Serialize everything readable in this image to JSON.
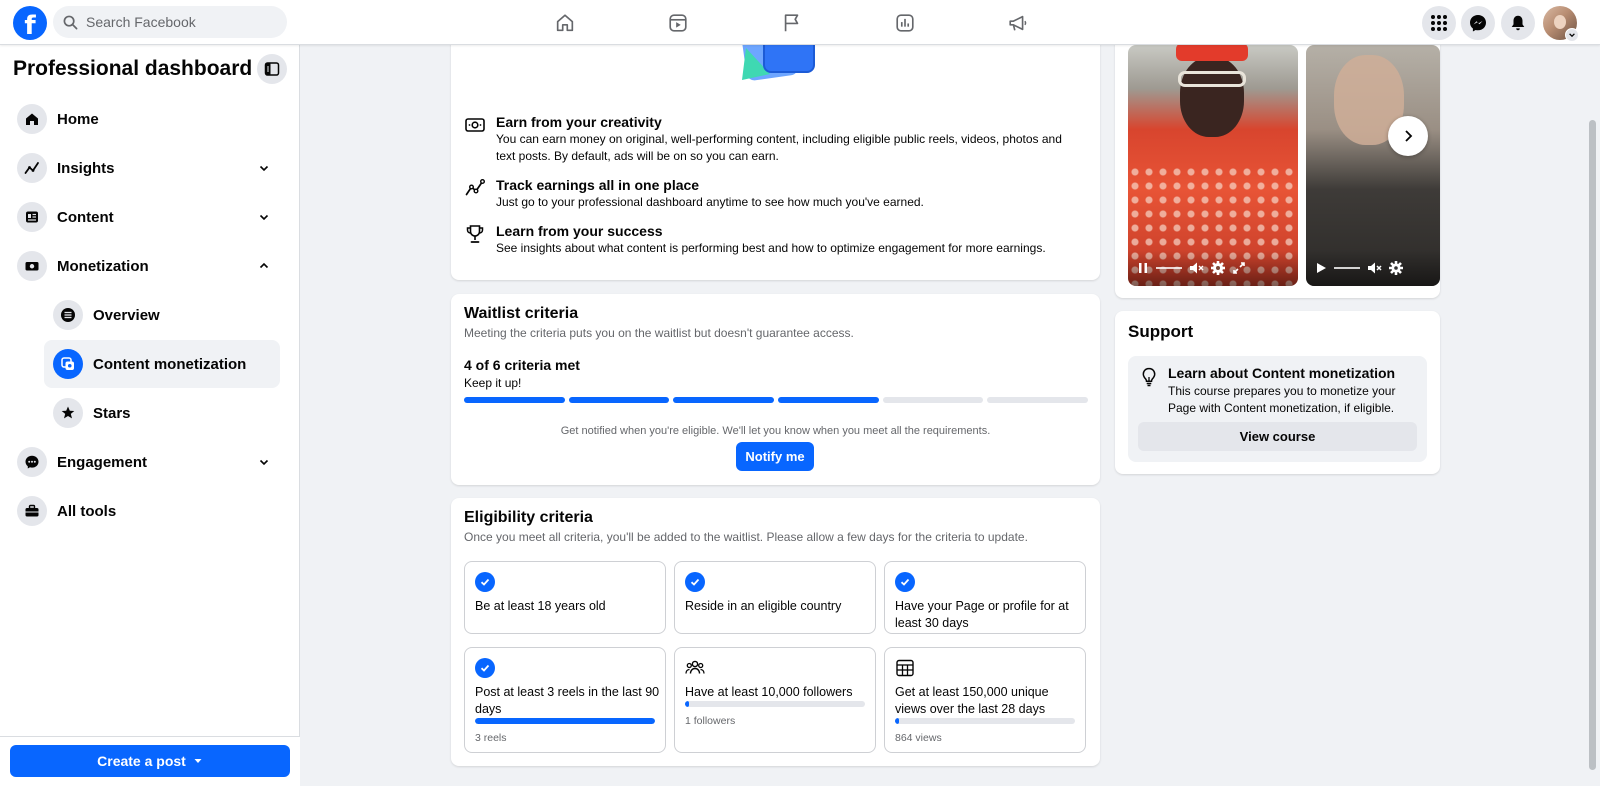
{
  "topbar": {
    "logo": "f",
    "search_placeholder": "Search Facebook",
    "nav_icons": [
      "home-icon",
      "video-icon",
      "pages-flag-icon",
      "insights-icon",
      "ads-megaphone-icon"
    ],
    "right_icons": [
      "menu-grid-icon",
      "messenger-icon",
      "notifications-bell-icon"
    ]
  },
  "sidebar": {
    "title": "Professional dashboard",
    "items": [
      {
        "label": "Home",
        "icon": "home-icon"
      },
      {
        "label": "Insights",
        "icon": "insights-icon"
      },
      {
        "label": "Content",
        "icon": "content-icon"
      },
      {
        "label": "Monetization",
        "icon": "monetization-icon"
      },
      {
        "label": "Overview",
        "icon": "list-icon"
      },
      {
        "label": "Content monetization",
        "icon": "content-monetization-icon"
      },
      {
        "label": "Stars",
        "icon": "stars-icon"
      },
      {
        "label": "Engagement",
        "icon": "engagement-icon"
      },
      {
        "label": "All tools",
        "icon": "toolbox-icon"
      }
    ],
    "create_post": "Create a post"
  },
  "benefits": [
    {
      "title": "Earn from your creativity",
      "desc": "You can earn money on original, well-performing content, including eligible public reels, videos, photos and text posts. By default, ads will be on so you can earn.",
      "icon": "cash-icon"
    },
    {
      "title": "Track earnings all in one place",
      "desc": "Just go to your professional dashboard anytime to see how much you've earned.",
      "icon": "trend-icon"
    },
    {
      "title": "Learn from your success",
      "desc": "See insights about what content is performing best and how to optimize engagement for more earnings.",
      "icon": "trophy-icon"
    }
  ],
  "waitlist": {
    "title": "Waitlist criteria",
    "subtitle": "Meeting the criteria puts you on the waitlist but doesn't guarantee access.",
    "met": "4 of 6 criteria met",
    "encouragement": "Keep it up!",
    "progress_met": 4,
    "progress_total": 6,
    "notify_text": "Get notified when you're eligible. We'll let you know when you meet all the requirements.",
    "notify_button": "Notify me"
  },
  "eligibility": {
    "title": "Eligibility criteria",
    "subtitle": "Once you meet all criteria, you'll be added to the waitlist. Please allow a few days for the criteria to update.",
    "criteria": [
      {
        "text": "Be at least 18 years old",
        "met": true
      },
      {
        "text": "Reside in an eligible country",
        "met": true
      },
      {
        "text": "Have your Page or profile for at least 30 days",
        "met": true
      },
      {
        "text": "Post at least 3 reels in the last 90 days",
        "met": true,
        "progress": 1.0,
        "note": "3 reels"
      },
      {
        "text": "Have at least 10,000 followers",
        "met": false,
        "icon": "people-icon",
        "progress": 0.0001,
        "note": "1 followers"
      },
      {
        "text": "Get at least 150,000 unique views over the last 28 days",
        "met": false,
        "icon": "table-icon",
        "progress": 0.0058,
        "note": "864 views"
      }
    ]
  },
  "support": {
    "title": "Support",
    "course_title": "Learn about Content monetization",
    "course_desc": "This course prepares you to monetize your Page with Content monetization, if eligible.",
    "course_button": "View course"
  },
  "colors": {
    "accent": "#0866ff",
    "page_bg": "#f0f2f5",
    "card_bg": "#ffffff",
    "muted_text": "#65676b"
  }
}
